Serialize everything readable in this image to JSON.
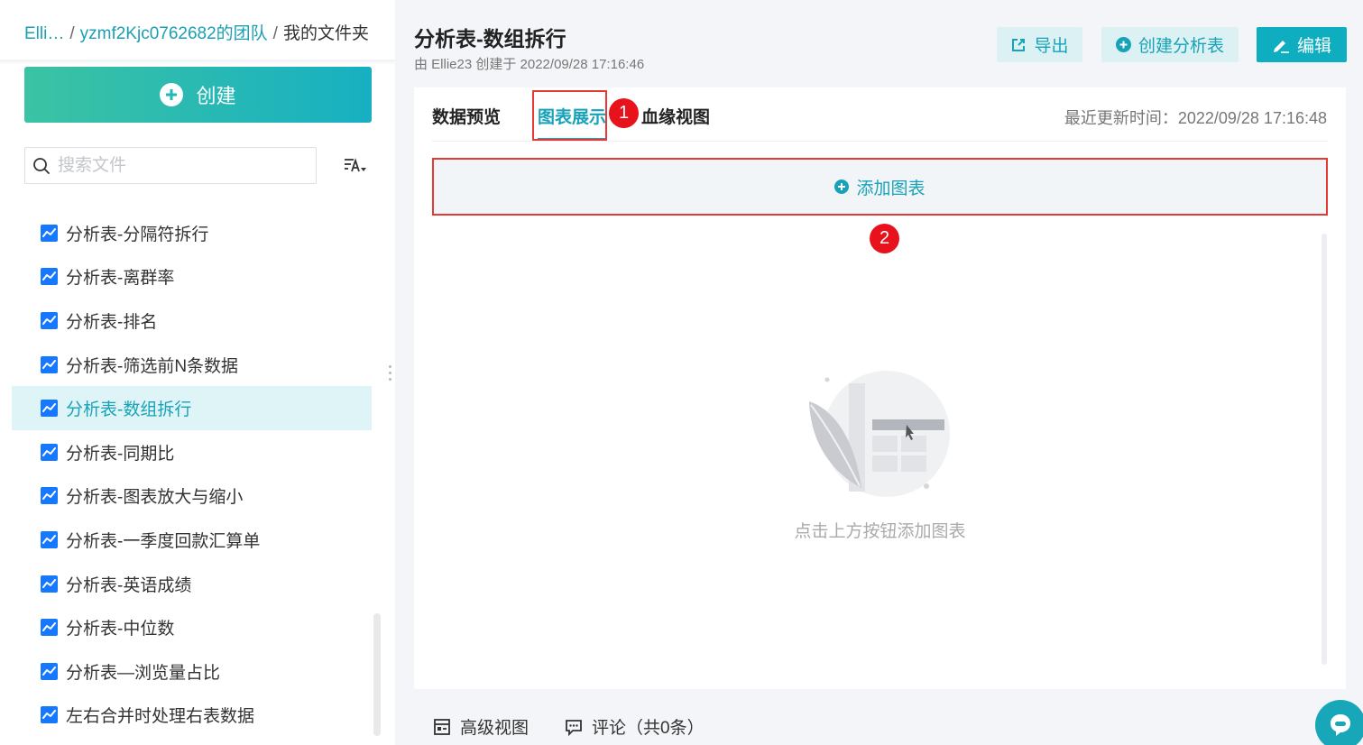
{
  "breadcrumb": {
    "part1": "Elli…",
    "sep1": "/",
    "part2": "yzmf2Kjc0762682的团队",
    "sep2": "/",
    "part3": "我的文件夹"
  },
  "sidebar": {
    "create_label": "创建",
    "search_placeholder": "搜索文件",
    "files": [
      {
        "label": "分析表-分隔符拆行",
        "active": false
      },
      {
        "label": "分析表-离群率",
        "active": false
      },
      {
        "label": "分析表-排名",
        "active": false
      },
      {
        "label": "分析表-筛选前N条数据",
        "active": false
      },
      {
        "label": "分析表-数组拆行",
        "active": true
      },
      {
        "label": "分析表-同期比",
        "active": false
      },
      {
        "label": "分析表-图表放大与缩小",
        "active": false
      },
      {
        "label": "分析表-一季度回款汇算单",
        "active": false
      },
      {
        "label": "分析表-英语成绩",
        "active": false
      },
      {
        "label": "分析表-中位数",
        "active": false
      },
      {
        "label": "分析表—浏览量占比",
        "active": false
      },
      {
        "label": "左右合并时处理右表数据",
        "active": false
      }
    ]
  },
  "header": {
    "title": "分析表-数组拆行",
    "subtitle": "由 Ellie23 创建于 2022/09/28 17:16:46",
    "export_label": "导出",
    "create_analysis_label": "创建分析表",
    "edit_label": "编辑"
  },
  "tabs": {
    "data_preview": "数据预览",
    "chart_display": "图表展示",
    "lineage_view": "血缘视图",
    "last_updated": "最近更新时间：2022/09/28 17:16:48"
  },
  "annotations": {
    "badge1": "1",
    "badge2": "2"
  },
  "main": {
    "add_chart_label": "添加图表",
    "empty_text": "点击上方按钮添加图表"
  },
  "footer": {
    "advanced_view": "高级视图",
    "comments": "评论（共0条）"
  },
  "colors": {
    "accent": "#17a2b8",
    "file_icon": "#1677ff",
    "annotation": "#e53935"
  }
}
